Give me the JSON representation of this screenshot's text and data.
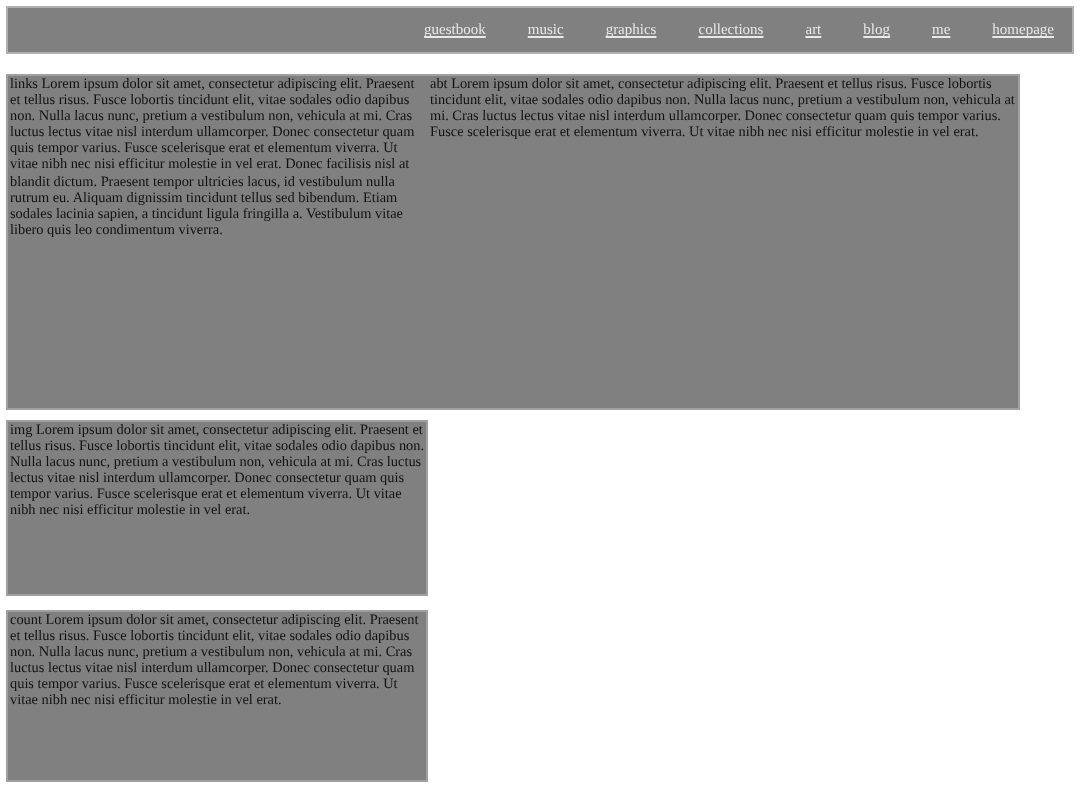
{
  "nav": {
    "links": [
      "guestbook",
      "music",
      "graphics",
      "collections",
      "art",
      "blog",
      "me",
      "homepage"
    ]
  },
  "main_panel": {
    "columns": [
      "links Lorem ipsum dolor sit amet, consectetur adipiscing elit. Praesent et tellus risus. Fusce lobortis tincidunt elit, vitae sodales odio dapibus non. Nulla lacus nunc, pretium a vestibulum non, vehicula at mi. Cras luctus lectus vitae nisl interdum ullamcorper. Donec consectetur quam quis tempor varius. Fusce scelerisque erat et elementum viverra. Ut vitae nibh nec nisi efficitur molestie in vel erat. Donec facilisis nisl at blandit dictum. Praesent tempor ultricies lacus, id vestibulum nulla rutrum eu. Aliquam dignissim tincidunt tellus sed bibendum. Etiam sodales lacinia sapien, a tincidunt ligula fringilla a. Vestibulum vitae libero quis leo condimentum viverra.",
      "abt Lorem ipsum dolor sit amet, consectetur adipiscing elit. Praesent et tellus risus. Fusce lobortis tincidunt elit, vitae sodales odio dapibus non. Nulla lacus nunc, pretium a vestibulum non, vehicula at mi. Cras luctus lectus vitae nisl interdum ullamcorper. Donec consectetur quam quis tempor varius. Fusce scelerisque erat et elementum viverra. Ut vitae nibh nec nisi efficitur molestie in vel erat."
    ]
  },
  "panels": [
    "img Lorem ipsum dolor sit amet, consectetur adipiscing elit. Praesent et tellus risus. Fusce lobortis tincidunt elit, vitae sodales odio dapibus non. Nulla lacus nunc, pretium a vestibulum non, vehicula at mi. Cras luctus lectus vitae nisl interdum ullamcorper. Donec consectetur quam quis tempor varius. Fusce scelerisque erat et elementum viverra. Ut vitae nibh nec nisi efficitur molestie in vel erat.",
    "count Lorem ipsum dolor sit amet, consectetur adipiscing elit. Praesent et tellus risus. Fusce lobortis tincidunt elit, vitae sodales odio dapibus non. Nulla lacus nunc, pretium a vestibulum non, vehicula at mi. Cras luctus lectus vitae nisl interdum ullamcorper. Donec consectetur quam quis tempor varius. Fusce scelerisque erat et elementum viverra. Ut vitae nibh nec nisi efficitur molestie in vel erat."
  ]
}
